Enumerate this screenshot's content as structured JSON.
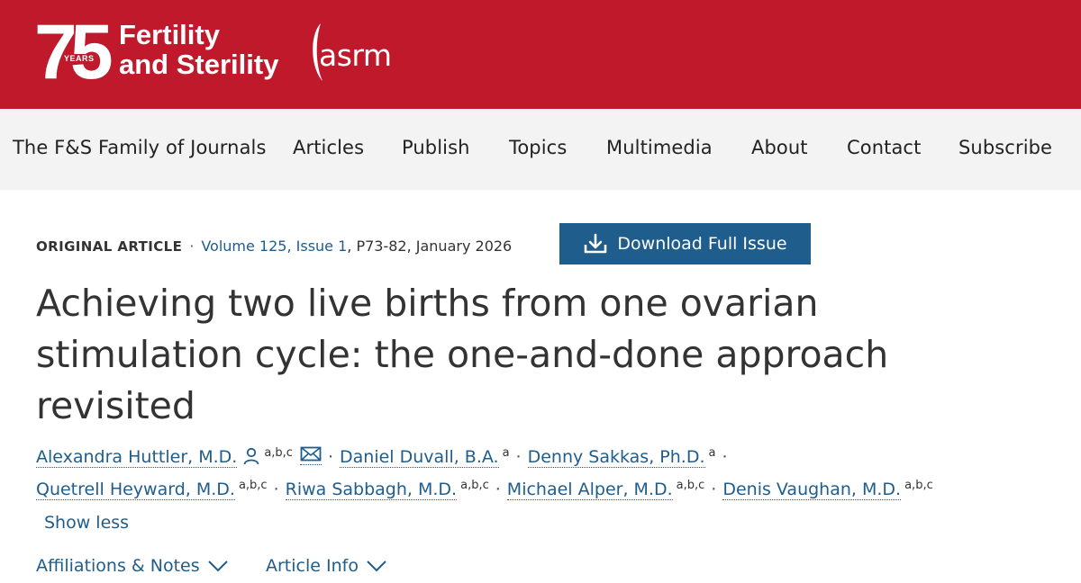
{
  "header": {
    "logo_number": "75",
    "logo_years": "YEARS",
    "journal_line1": "Fertility",
    "journal_line2": "and Sterility",
    "partner": "asrm",
    "brand_color": "#c0192c"
  },
  "nav": {
    "items": [
      {
        "label": "The F&S Family of Journals"
      },
      {
        "label": "Articles"
      },
      {
        "label": "Publish"
      },
      {
        "label": "Topics"
      },
      {
        "label": "Multimedia"
      },
      {
        "label": "About"
      },
      {
        "label": "Contact"
      },
      {
        "label": "Subscribe"
      }
    ]
  },
  "article": {
    "type": "ORIGINAL ARTICLE",
    "volume_issue": "Volume 125, Issue 1",
    "pages_date": ", P73-82, January 2026",
    "download_label": "Download Full Issue",
    "title": "Achieving two live births from one ovarian stimulation cycle: the one-and-done approach revisited",
    "authors": [
      {
        "name": "Alexandra Huttler, M.D.",
        "aff": "a,b,c",
        "icons": [
          "person-icon",
          "envelope-icon"
        ]
      },
      {
        "name": "Daniel Duvall, B.A.",
        "aff": "a"
      },
      {
        "name": "Denny Sakkas, Ph.D.",
        "aff": "a"
      },
      {
        "name": "Quetrell Heyward, M.D.",
        "aff": "a,b,c"
      },
      {
        "name": "Riwa Sabbagh, M.D.",
        "aff": "a,b,c"
      },
      {
        "name": "Michael Alper, M.D.",
        "aff": "a,b,c"
      },
      {
        "name": "Denis Vaughan, M.D.",
        "aff": "a,b,c"
      }
    ],
    "show_less": "Show less",
    "affiliations_label": "Affiliations & Notes",
    "article_info_label": "Article Info",
    "link_color": "#1e5d8c"
  }
}
